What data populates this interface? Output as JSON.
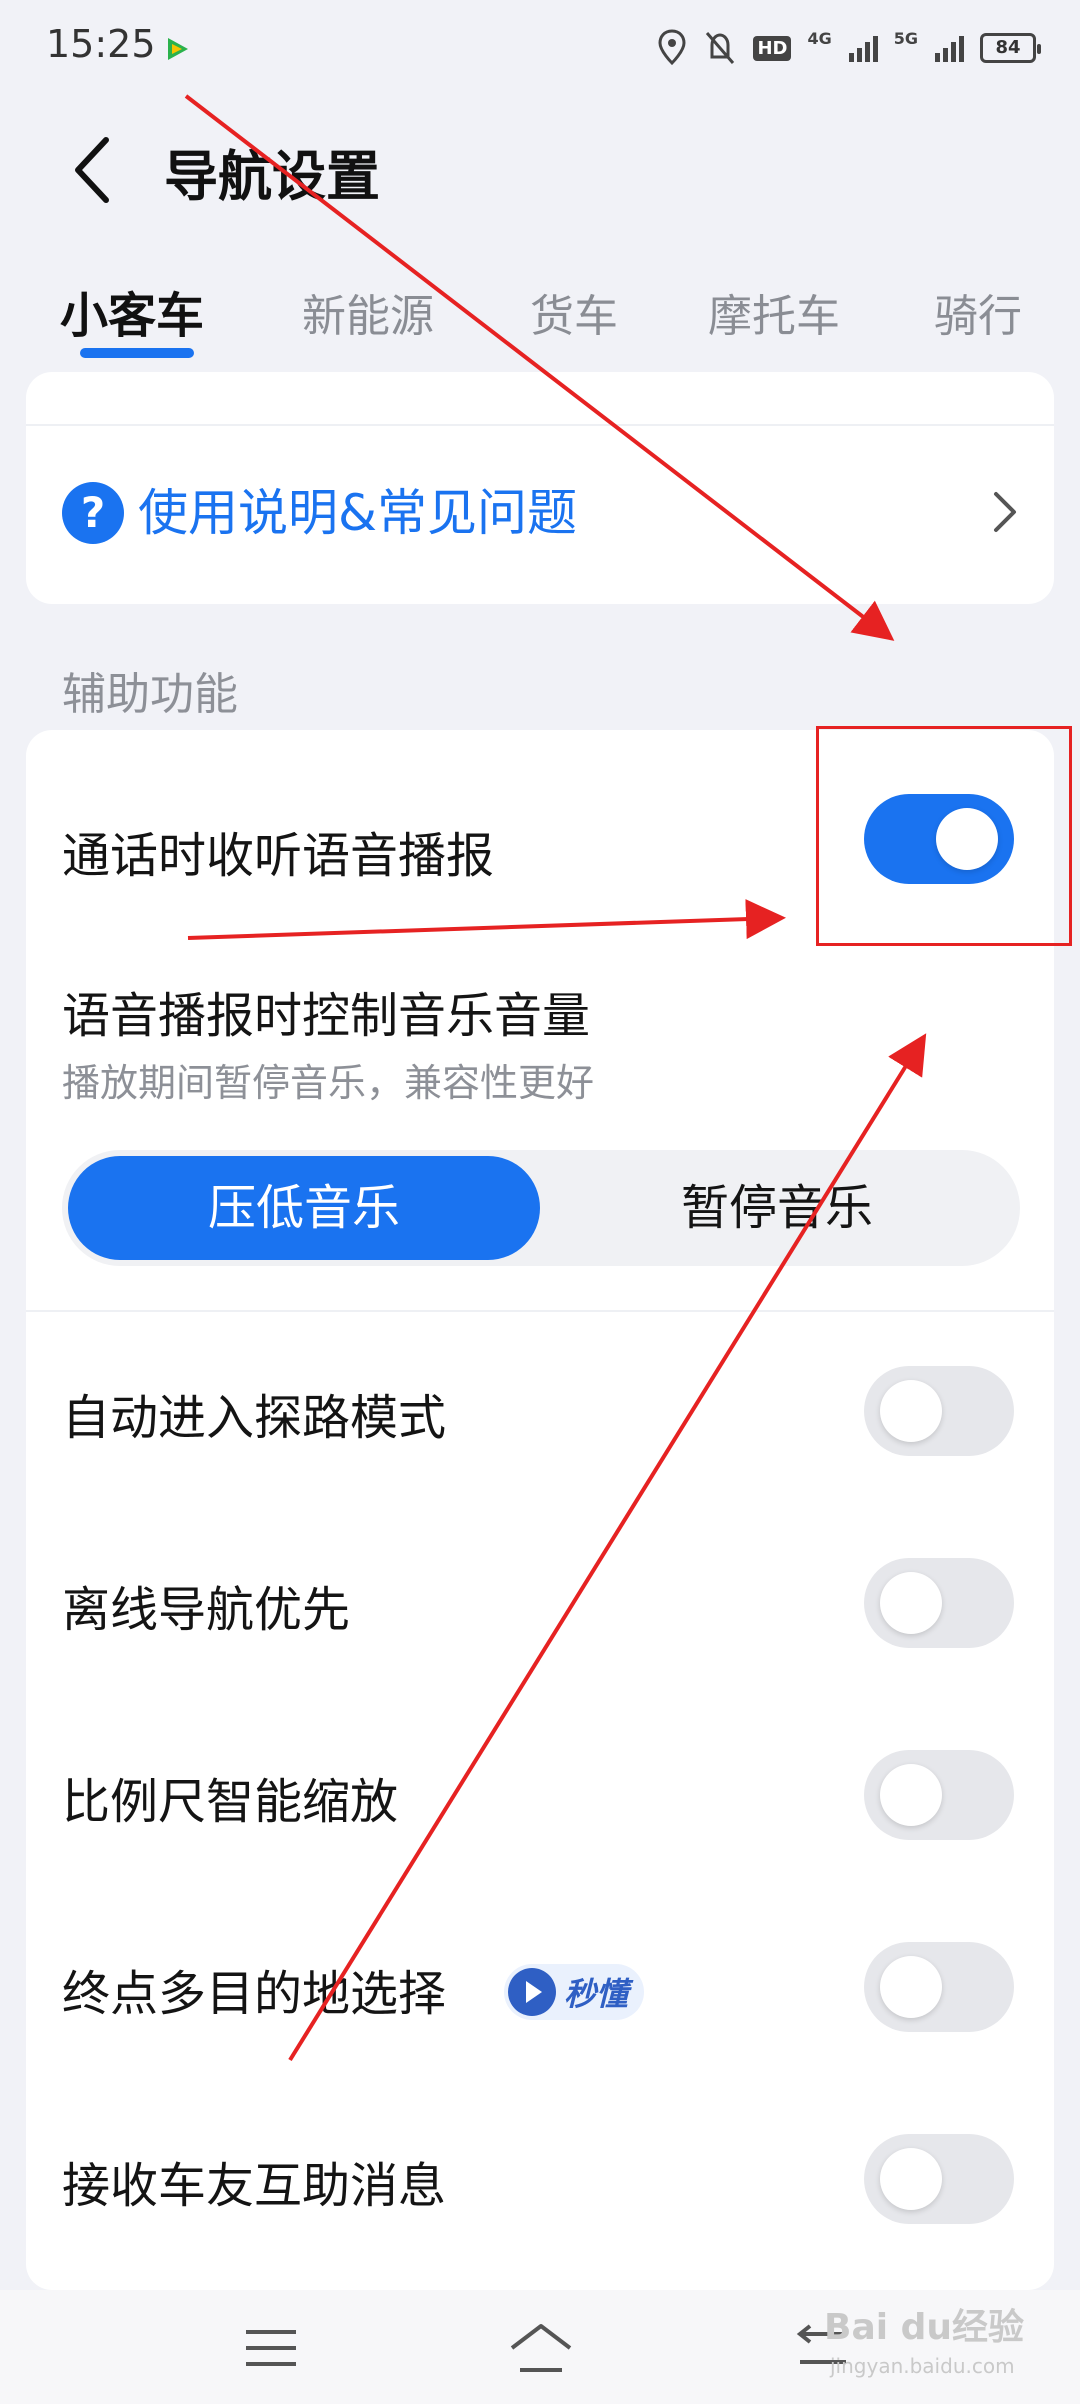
{
  "status_bar": {
    "time": "15:25",
    "battery": "84",
    "network_1": "4G",
    "network_2": "5G",
    "hd_label": "HD",
    "icons": [
      "location-icon",
      "bell-muted-icon",
      "hd-icon",
      "signal-icon",
      "battery-icon"
    ]
  },
  "header": {
    "title": "导航设置",
    "back_icon": "chevron-left-icon"
  },
  "tabs": [
    {
      "label": "小客车",
      "active": true
    },
    {
      "label": "新能源",
      "active": false
    },
    {
      "label": "货车",
      "active": false
    },
    {
      "label": "摩托车",
      "active": false
    },
    {
      "label": "骑行",
      "active": false
    }
  ],
  "help": {
    "label": "使用说明&常见问题",
    "icon": "question-circle-icon"
  },
  "section_title": "辅助功能",
  "settings": {
    "call_voice": {
      "label": "通话时收听语音播报",
      "enabled": true
    },
    "music_control": {
      "label": "语音播报时控制音乐音量",
      "subtitle": "播放期间暂停音乐，兼容性更好",
      "options": [
        "压低音乐",
        "暂停音乐"
      ],
      "selected": "压低音乐"
    },
    "explore_mode": {
      "label": "自动进入探路模式",
      "enabled": false
    },
    "offline_first": {
      "label": "离线导航优先",
      "enabled": false
    },
    "smart_scale": {
      "label": "比例尺智能缩放",
      "enabled": false
    },
    "multi_destination": {
      "label": "终点多目的地选择",
      "badge": "秒懂",
      "enabled": false
    },
    "car_friend": {
      "label": "接收车友互助消息",
      "enabled": false
    }
  },
  "nav_bar": {
    "icons": [
      "menu-icon",
      "home-icon",
      "back-icon"
    ]
  },
  "watermark": {
    "text": "Bai du经验",
    "sub": "jingyan.baidu.com"
  },
  "colors": {
    "accent": "#1a73f0",
    "annotation": "#e62222",
    "background": "#f1f2f7"
  }
}
